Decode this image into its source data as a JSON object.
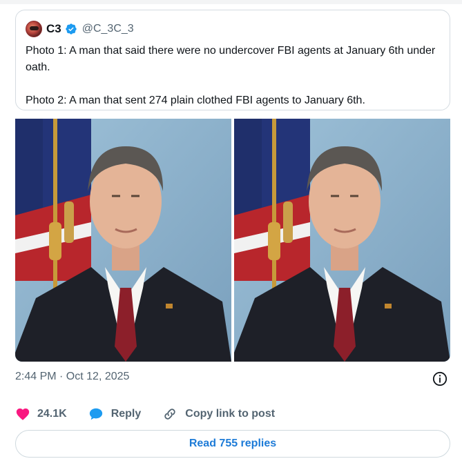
{
  "tweet": {
    "author_name": "C3",
    "author_handle": "@C_3C_3",
    "text_paragraphs": [
      "Photo 1: A man that said there were no undercover FBI agents at January 6th under oath.",
      "Photo 2: A man that sent 274 plain clothed FBI agents to January 6th."
    ],
    "timestamp": "2:44 PM · Oct 12, 2025",
    "likes": "24.1K",
    "reply_label": "Reply",
    "copy_link_label": "Copy link to post",
    "read_replies_label": "Read 755 replies"
  },
  "icons": {
    "verified": "verified-badge-icon",
    "info": "info-icon",
    "like": "heart-icon",
    "reply": "speech-bubble-icon",
    "copy": "link-icon"
  },
  "colors": {
    "accent": "#1d9bf0",
    "like": "#f91880",
    "muted": "#536471",
    "link_button_text": "#1d7bd7"
  }
}
